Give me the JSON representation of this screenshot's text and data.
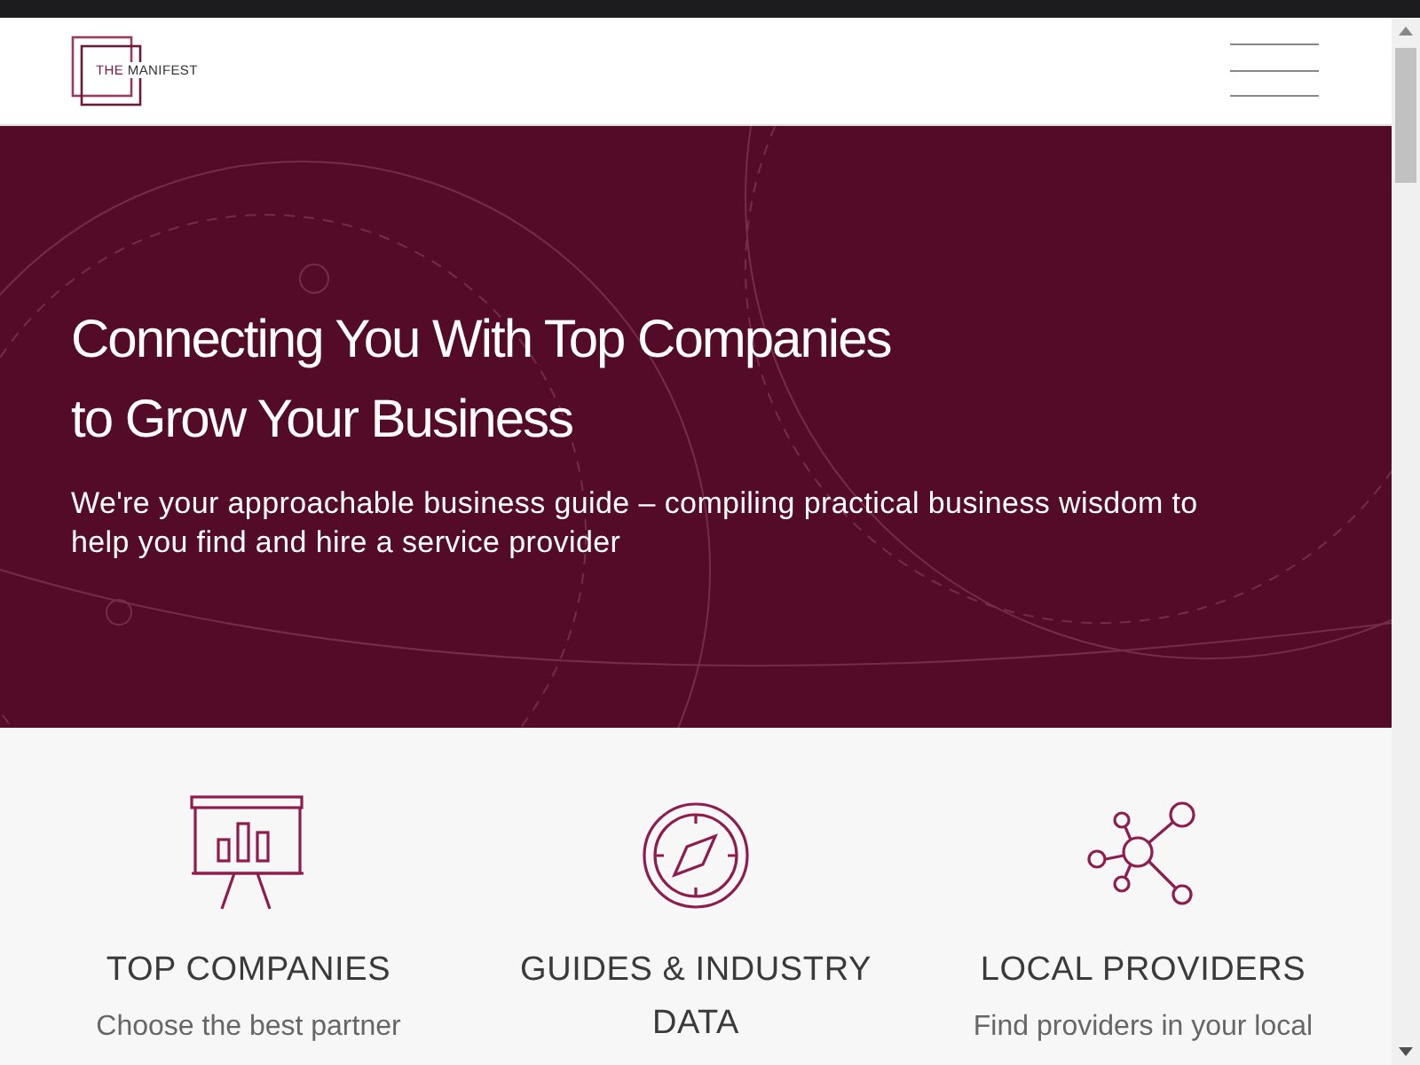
{
  "header": {
    "logo": {
      "text_accent": "THE",
      "text_main": "MANIFEST"
    }
  },
  "hero": {
    "title_lines": [
      "Connecting You With Top Companies",
      "to Grow Your Business"
    ],
    "subtitle": "We're your approachable business guide – compiling practical business wisdom to help you find and hire a service provider"
  },
  "features": [
    {
      "kind": "presentation",
      "title_lines": [
        "TOP COMPANIES"
      ],
      "text_lines": [
        "Choose the best partner"
      ]
    },
    {
      "kind": "compass",
      "title_lines": [
        "GUIDES & INDUSTRY",
        "DATA"
      ]
    },
    {
      "kind": "network",
      "title_lines": [
        "LOCAL PROVIDERS"
      ],
      "text_lines": [
        "Find providers in your local"
      ]
    }
  ]
}
